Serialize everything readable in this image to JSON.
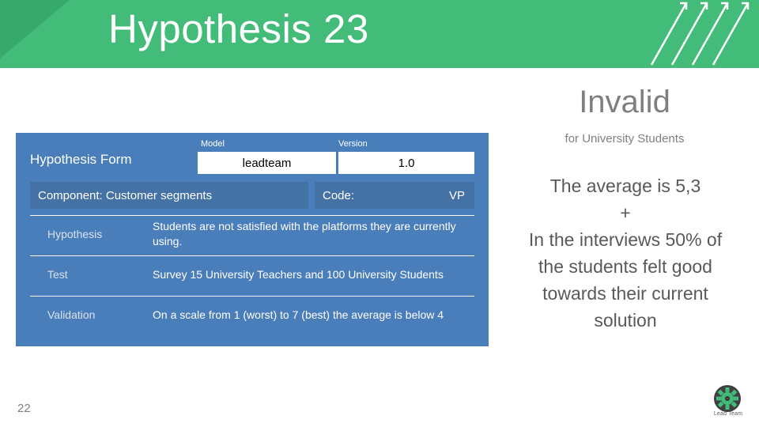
{
  "header": {
    "title": "Hypothesis 23"
  },
  "form": {
    "title": "Hypothesis Form",
    "model_label": "Model",
    "model_value": "leadteam",
    "version_label": "Version",
    "version_value": "1.0",
    "component_label": "Component:  Customer segments",
    "code_label": "Code:",
    "code_value": "VP",
    "rows": [
      {
        "label": "Hypothesis",
        "value": "Students are not satisfied with the platforms they are currently using."
      },
      {
        "label": "Test",
        "value": "Survey 15 University Teachers and 100 University Students"
      },
      {
        "label": "Validation",
        "value": "On a scale from 1 (worst) to 7 (best)  the average is below 4"
      }
    ]
  },
  "result": {
    "status": "Invalid",
    "subtitle": "for University Students",
    "lines": [
      "The average is 5,3",
      "+",
      "In the interviews 50% of",
      "the students felt good",
      "towards their current",
      "solution"
    ]
  },
  "footer": {
    "page_number": "22",
    "logo_text": "Lead Team"
  },
  "colors": {
    "header_green": "#43bb79",
    "header_green_dark": "#37a96c",
    "form_blue": "#4a7ebb",
    "form_blue_dark": "#4472a4",
    "gray_text": "#7f7f7f"
  }
}
